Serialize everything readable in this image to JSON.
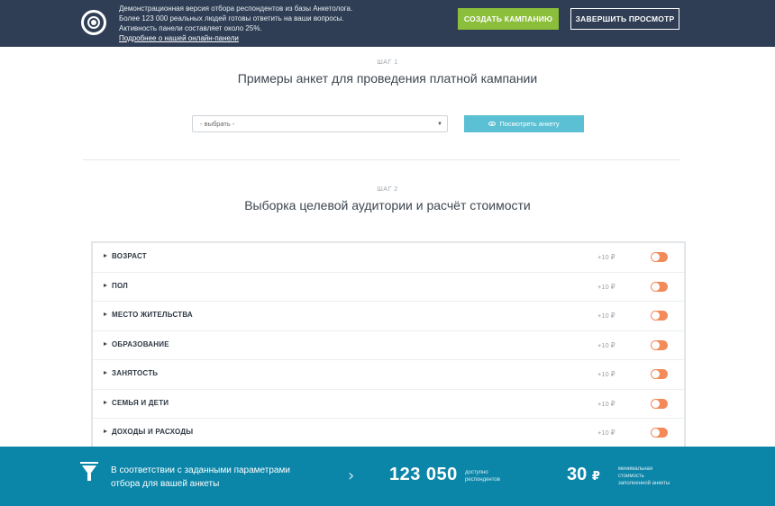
{
  "topbar": {
    "info_line1": "Демонстрационная версия отбора респондентов из базы Анкетолога.",
    "info_line2": "Более 123 000 реальных людей готовы ответить на ваши вопросы.",
    "info_line3": "Активность панели составляет около 25%.",
    "info_link": "Подробнее о нашей онлайн-панели",
    "create_button": "СОЗДАТЬ КАМПАНИЮ",
    "finish_button": "ЗАВЕРШИТЬ ПРОСМОТР",
    "background": "#2f3e55",
    "create_color": "#8bbe3a"
  },
  "step1": {
    "label": "ШАГ 1",
    "title": "Примеры анкет для проведения платной кампании",
    "select_value": "- выбрать -",
    "view_button": "Посмотреть анкету",
    "view_color": "#5bc0d3"
  },
  "step2": {
    "label": "ШАГ 2",
    "title": "Выборка целевой аудитории и расчёт стоимости",
    "toggle_color": "#f28a5a",
    "rows": [
      {
        "label": "ВОЗРАСТ",
        "price": "+10 ₽",
        "enabled": false
      },
      {
        "label": "ПОЛ",
        "price": "+10 ₽",
        "enabled": false
      },
      {
        "label": "МЕСТО ЖИТЕЛЬСТВА",
        "price": "+10 ₽",
        "enabled": false
      },
      {
        "label": "ОБРАЗОВАНИЕ",
        "price": "+10 ₽",
        "enabled": false
      },
      {
        "label": "ЗАНЯТОСТЬ",
        "price": "+10 ₽",
        "enabled": false
      },
      {
        "label": "СЕМЬЯ И ДЕТИ",
        "price": "+10 ₽",
        "enabled": false
      },
      {
        "label": "ДОХОДЫ И РАСХОДЫ",
        "price": "+10 ₽",
        "enabled": false
      }
    ]
  },
  "footer": {
    "text_line1": "В соответствии с заданными параметрами",
    "text_line2": "отбора для вашей анкеты",
    "respondents": "123 050",
    "respondents_cap1": "доступно",
    "respondents_cap2": "респондентов",
    "cost": "30",
    "currency": "₽",
    "cost_cap1": "минимальная",
    "cost_cap2": "стоимость",
    "cost_cap3": "заполненной анкеты",
    "background": "#0b85a8"
  }
}
